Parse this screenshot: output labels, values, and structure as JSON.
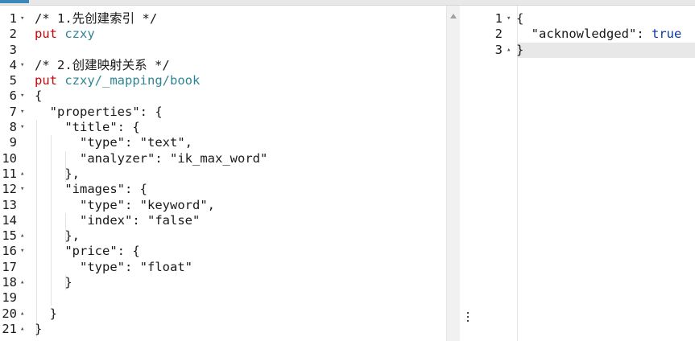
{
  "request_editor": {
    "lines": [
      [
        {
          "t": "/* 1.先创建索引 */",
          "c": "comment"
        }
      ],
      [
        {
          "t": "put",
          "c": "method"
        },
        {
          "t": " ",
          "c": "punct"
        },
        {
          "t": "czxy",
          "c": "url"
        }
      ],
      [],
      [
        {
          "t": "/* 2.创建映射关系 */",
          "c": "comment"
        }
      ],
      [
        {
          "t": "put",
          "c": "method"
        },
        {
          "t": " ",
          "c": "punct"
        },
        {
          "t": "czxy/_mapping/book",
          "c": "url"
        }
      ],
      [
        {
          "t": "{",
          "c": "punct"
        }
      ],
      [
        {
          "t": "  ",
          "c": "punct"
        },
        {
          "t": "\"properties\"",
          "c": "key"
        },
        {
          "t": ": {",
          "c": "punct"
        }
      ],
      [
        {
          "t": "    ",
          "c": "punct"
        },
        {
          "t": "\"title\"",
          "c": "key"
        },
        {
          "t": ": {",
          "c": "punct"
        }
      ],
      [
        {
          "t": "      ",
          "c": "punct"
        },
        {
          "t": "\"type\"",
          "c": "key"
        },
        {
          "t": ": ",
          "c": "punct"
        },
        {
          "t": "\"text\"",
          "c": "string"
        },
        {
          "t": ",",
          "c": "punct"
        }
      ],
      [
        {
          "t": "      ",
          "c": "punct"
        },
        {
          "t": "\"analyzer\"",
          "c": "key"
        },
        {
          "t": ": ",
          "c": "punct"
        },
        {
          "t": "\"ik_max_word\"",
          "c": "string"
        }
      ],
      [
        {
          "t": "    },",
          "c": "punct"
        }
      ],
      [
        {
          "t": "    ",
          "c": "punct"
        },
        {
          "t": "\"images\"",
          "c": "key"
        },
        {
          "t": ": {",
          "c": "punct"
        }
      ],
      [
        {
          "t": "      ",
          "c": "punct"
        },
        {
          "t": "\"type\"",
          "c": "key"
        },
        {
          "t": ": ",
          "c": "punct"
        },
        {
          "t": "\"keyword\"",
          "c": "string"
        },
        {
          "t": ",",
          "c": "punct"
        }
      ],
      [
        {
          "t": "      ",
          "c": "punct"
        },
        {
          "t": "\"index\"",
          "c": "key"
        },
        {
          "t": ": ",
          "c": "punct"
        },
        {
          "t": "\"false\"",
          "c": "string"
        }
      ],
      [
        {
          "t": "    },",
          "c": "punct"
        }
      ],
      [
        {
          "t": "    ",
          "c": "punct"
        },
        {
          "t": "\"price\"",
          "c": "key"
        },
        {
          "t": ": {",
          "c": "punct"
        }
      ],
      [
        {
          "t": "      ",
          "c": "punct"
        },
        {
          "t": "\"type\"",
          "c": "key"
        },
        {
          "t": ": ",
          "c": "punct"
        },
        {
          "t": "\"float\"",
          "c": "string"
        }
      ],
      [
        {
          "t": "    }",
          "c": "punct"
        }
      ],
      [],
      [
        {
          "t": "  }",
          "c": "punct"
        }
      ],
      [
        {
          "t": "}",
          "c": "punct"
        }
      ]
    ],
    "gutter": [
      {
        "n": "1",
        "fold": "▾"
      },
      {
        "n": "2",
        "fold": ""
      },
      {
        "n": "3",
        "fold": ""
      },
      {
        "n": "4",
        "fold": "▾"
      },
      {
        "n": "5",
        "fold": ""
      },
      {
        "n": "6",
        "fold": "▾"
      },
      {
        "n": "7",
        "fold": "▾"
      },
      {
        "n": "8",
        "fold": "▾"
      },
      {
        "n": "9",
        "fold": ""
      },
      {
        "n": "10",
        "fold": ""
      },
      {
        "n": "11",
        "fold": "▴"
      },
      {
        "n": "12",
        "fold": "▾"
      },
      {
        "n": "13",
        "fold": ""
      },
      {
        "n": "14",
        "fold": ""
      },
      {
        "n": "15",
        "fold": "▴"
      },
      {
        "n": "16",
        "fold": "▾"
      },
      {
        "n": "17",
        "fold": ""
      },
      {
        "n": "18",
        "fold": "▴"
      },
      {
        "n": "19",
        "fold": ""
      },
      {
        "n": "20",
        "fold": "▴"
      },
      {
        "n": "21",
        "fold": "▴"
      }
    ]
  },
  "response_viewer": {
    "lines": [
      [
        {
          "t": "{",
          "c": "punct"
        }
      ],
      [
        {
          "t": "  ",
          "c": "punct"
        },
        {
          "t": "\"acknowledged\"",
          "c": "key"
        },
        {
          "t": ": ",
          "c": "punct"
        },
        {
          "t": "true",
          "c": "bool"
        }
      ],
      [
        {
          "t": "}",
          "c": "punct"
        }
      ]
    ],
    "gutter": [
      {
        "n": "1",
        "fold": "▾"
      },
      {
        "n": "2",
        "fold": ""
      },
      {
        "n": "3",
        "fold": "▴"
      }
    ],
    "active_line": 3
  },
  "splitter": {
    "handle_icon": "vertical-dots-icon"
  },
  "colors": {
    "method": "#c5060b",
    "url": "#318495",
    "bool": "#0a3aa8",
    "active_line_bg": "#e8e8e8"
  }
}
